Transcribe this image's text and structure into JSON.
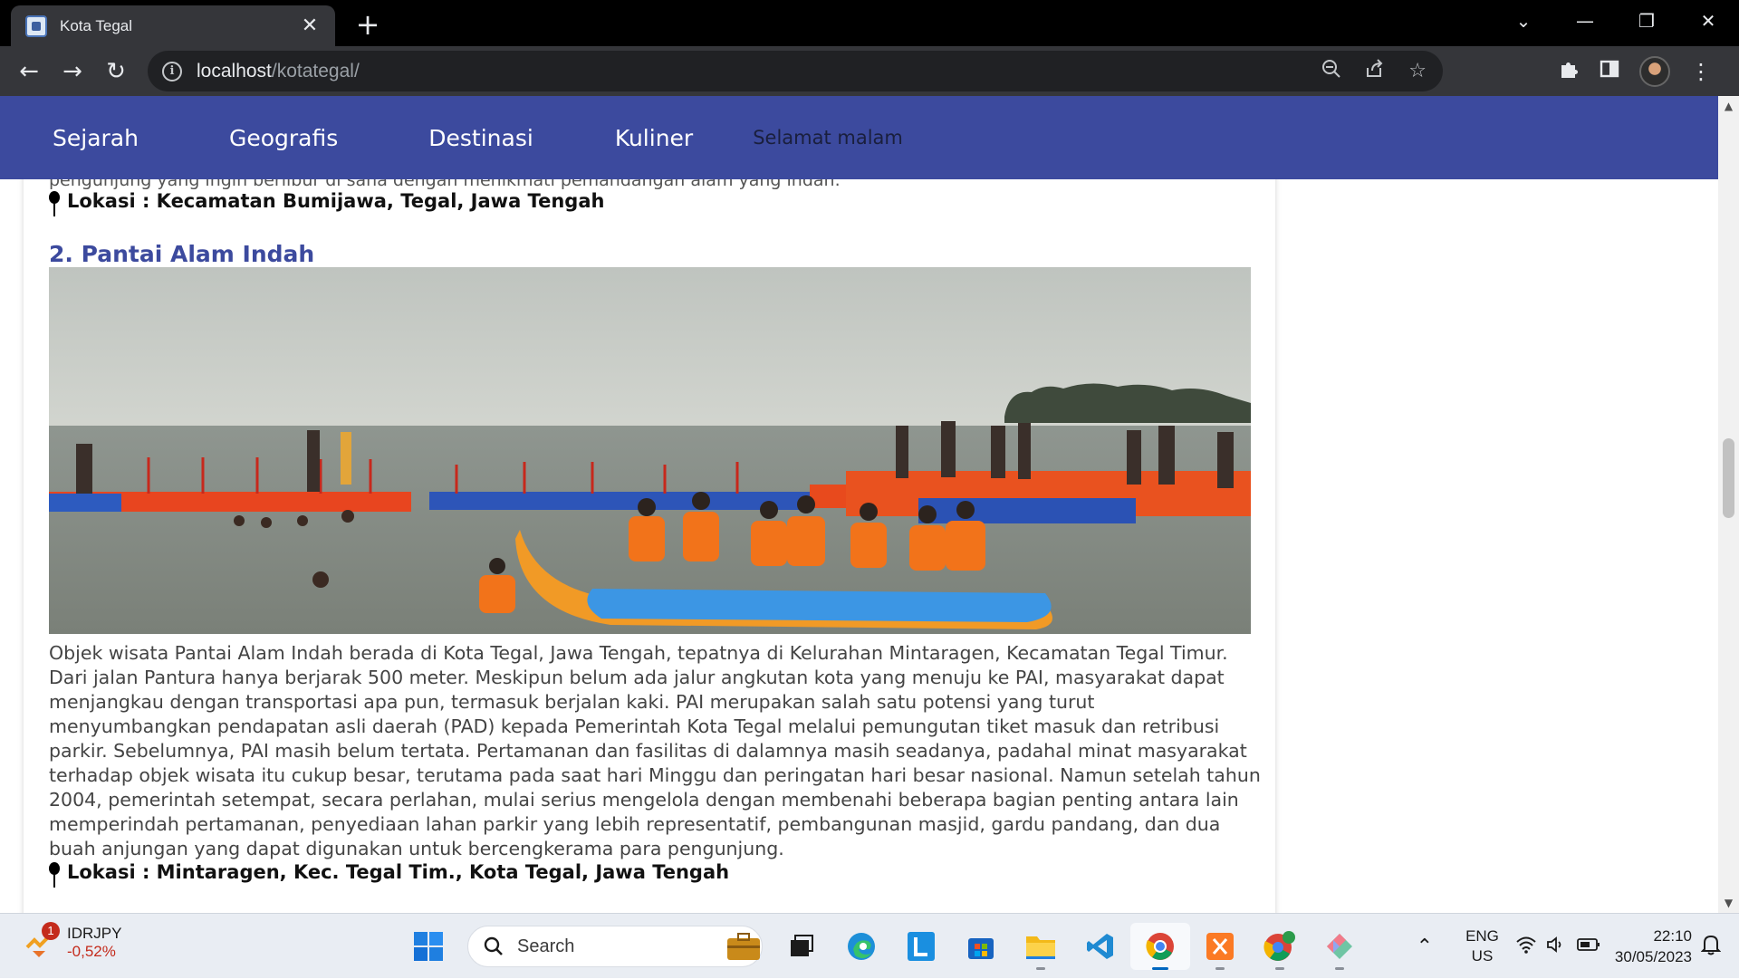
{
  "browser": {
    "tab_title": "Kota Tegal",
    "new_tab_symbol": "+",
    "url_host": "localhost",
    "url_path": "/kotategal/"
  },
  "navbar": {
    "links": [
      "Sejarah",
      "Geografis",
      "Destinasi",
      "Kuliner"
    ],
    "greeting": "Selamat malam"
  },
  "page": {
    "prev_text_fragment": "pengunjung yang ingin berlibur di sana dengan menikmati pemandangan alam yang indah.",
    "prev_location": "Lokasi : Kecamatan Bumijawa, Tegal, Jawa Tengah",
    "section_title": "2. Pantai Alam Indah",
    "photo_icon": "beach-banana-boat-photo",
    "description": "Objek wisata Pantai Alam Indah berada di Kota Tegal, Jawa Tengah, tepatnya di Kelurahan Mintaragen, Kecamatan Tegal Timur. Dari jalan Pantura hanya berjarak 500 meter. Meskipun belum ada jalur angkutan kota yang menuju ke PAI, masyarakat dapat menjangkau dengan transportasi apa pun, termasuk berjalan kaki. PAI merupakan salah satu potensi yang turut menyumbangkan pendapatan asli daerah (PAD) kepada Pemerintah Kota Tegal melalui pemungutan tiket masuk dan retribusi parkir. Sebelumnya, PAI masih belum tertata. Pertamanan dan fasilitas di dalamnya masih seadanya, padahal minat masyarakat terhadap objek wisata itu cukup besar, terutama pada saat hari Minggu dan peringatan hari besar nasional. Namun setelah tahun 2004, pemerintah setempat, secara perlahan, mulai serius mengelola dengan membenahi beberapa bagian penting antara lain memperindah pertamanan, penyediaan lahan parkir yang lebih representatif, pembangunan masjid, gardu pandang, dan dua buah anjungan yang dapat digunakan untuk bercengkerama para pengunjung.",
    "location": "Lokasi : Mintaragen, Kec. Tegal Tim., Kota Tegal, Jawa Tengah"
  },
  "taskbar": {
    "stock_badge": "1",
    "stock_name": "IDRJPY",
    "stock_change": "-0,52%",
    "search_label": "Search",
    "lang_line1": "ENG",
    "lang_line2": "US",
    "time": "22:10",
    "date": "30/05/2023"
  },
  "colors": {
    "navbar": "#3c4a9e",
    "section_title": "#3c4a9e",
    "chrome_dark": "#35363a",
    "stock_negative": "#c42b1c"
  }
}
